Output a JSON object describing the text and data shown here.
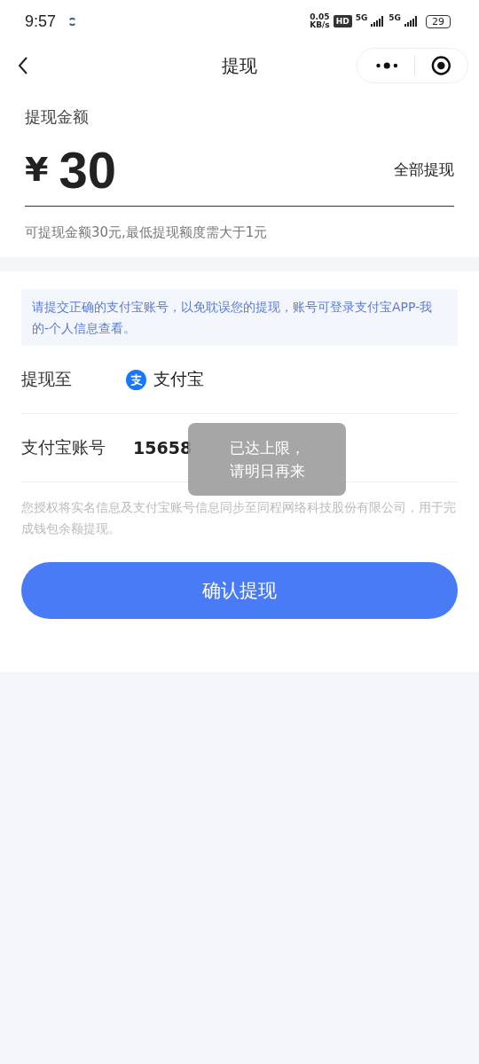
{
  "status_bar": {
    "time": "9:57",
    "net_speed_value": "0.05",
    "net_speed_unit": "KB/s",
    "hd_badge": "HD",
    "network_1": "5G",
    "network_2": "5G",
    "battery": "29"
  },
  "nav": {
    "title": "提现"
  },
  "amount": {
    "label": "提现金额",
    "currency": "¥",
    "value": "30",
    "all_button": "全部提现",
    "hint": "可提现金额30元,最低提现额度需大于1元"
  },
  "notice": "请提交正确的支付宝账号，以免耽误您的提现，账号可登录支付宝APP-我的-个人信息查看。",
  "rows": [
    {
      "label": "提现至",
      "value": "支付宝",
      "kind": "method"
    },
    {
      "label": "支付宝账号",
      "value": "15658",
      "kind": "account"
    }
  ],
  "consent": "您授权将实名信息及支付宝账号信息同步至同程网络科技股份有限公司，用于完成钱包余额提现。",
  "confirm_button": "确认提现",
  "toast": [
    "已达上限，",
    "请明日再来"
  ]
}
